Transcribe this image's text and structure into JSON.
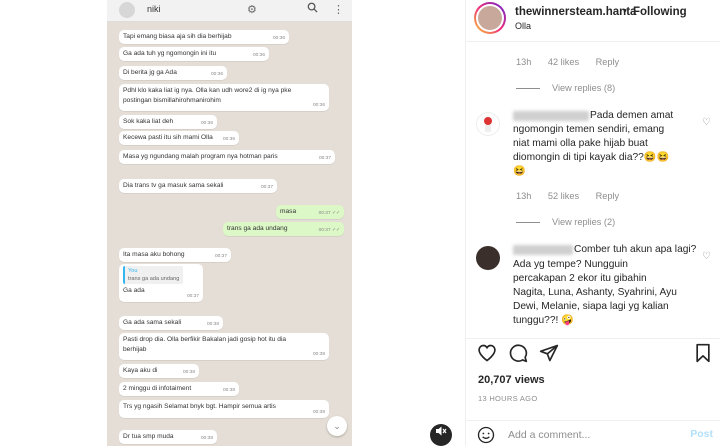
{
  "chat": {
    "contact_name": "niki",
    "header_icons": [
      "settings-icon",
      "search-icon",
      "more-vert-icon"
    ],
    "messages": [
      {
        "dir": "in",
        "text": "Tapi emang biasa aja sih dia berhijab",
        "time": "00:36"
      },
      {
        "dir": "in",
        "text": "Ga ada tuh yg ngomongin ini itu",
        "time": "00:36"
      },
      {
        "dir": "in",
        "text": "Di berita jg ga Ada",
        "time": "00:36"
      },
      {
        "dir": "in",
        "text": "Pdhl klo kaka liat ig nya. Olla kan udh wore2 di ig nya pke postingan bismillahirohmanirohim",
        "time": "00:36"
      },
      {
        "dir": "in",
        "text": "Sok kaka liat deh",
        "time": "00:36"
      },
      {
        "dir": "in",
        "text": "Kecewa pasti itu sih mami Olla",
        "time": "00:36"
      },
      {
        "dir": "in",
        "text": "Masa yg ngundang malah program nya hotman paris",
        "time": "00:37"
      },
      {
        "dir": "in",
        "text": "Dia trans tv ga masuk sama sekali",
        "time": "00:37"
      },
      {
        "dir": "out",
        "text": "masa",
        "time": "00:37 ✓✓"
      },
      {
        "dir": "out",
        "text": "trans ga ada undang",
        "time": "00:37 ✓✓"
      },
      {
        "dir": "in",
        "text": "Ita masa aku bohong",
        "time": "00:37"
      },
      {
        "dir": "in",
        "quote_name": "You",
        "quote_text": "trans ga ada undang",
        "text": "Ga ada",
        "time": "00:37"
      },
      {
        "dir": "in",
        "text": "Ga ada sama sekali",
        "time": "00:38"
      },
      {
        "dir": "in",
        "text": "Pasti drop dia. Olla berfikir Bakalan jadi gosip hot itu dia berhijab",
        "time": "00:38"
      },
      {
        "dir": "in",
        "text": "Kaya aku di",
        "time": "00:38"
      },
      {
        "dir": "in",
        "text": "2 minggu di infotaiment",
        "time": "00:38"
      },
      {
        "dir": "in",
        "text": "Trs yg ngasih Selamat bnyk bgt. Hampir semua artis",
        "time": "00:38"
      },
      {
        "dir": "in",
        "text": "Dr tua smp muda",
        "time": "00:38"
      }
    ]
  },
  "post": {
    "username": "thewinnersteam.hanta",
    "dot": "•",
    "follow_status": "Following",
    "location": "Olla",
    "comments": [
      {
        "time": "13h",
        "likes": "42 likes",
        "reply": "Reply",
        "view_replies": "View replies (8)"
      },
      {
        "text_lines": [
          "Pada demen amat",
          "ngomongin temen sendiri, emang",
          "niat mami olla pake hijab buat",
          "diomongin di tipi kayak dia??😆😆",
          "😆"
        ],
        "time": "13h",
        "likes": "52 likes",
        "reply": "Reply",
        "view_replies": "View replies (2)"
      },
      {
        "text_lines": [
          "Comber tuh akun apa lagi?",
          "Ada yg tempe? Nungguin",
          "percakapan 2 ekor itu gibahin",
          "Nagita, Luna, Ashanty, Syahrini, Ayu",
          "Dewi, Melanie, siapa lagi yg kalian",
          "tunggu??! 🤪"
        ]
      }
    ],
    "views": "20,707 views",
    "time_ago": "13 HOURS AGO",
    "add_comment_placeholder": "Add a comment...",
    "post_label": "Post"
  },
  "icons": {
    "heart": "heart-icon",
    "comment": "comment-icon",
    "share": "share-icon",
    "save": "bookmark-icon",
    "emoji": "emoji-icon",
    "mute": "mute-icon",
    "scroll": "chevron-down-icon"
  }
}
